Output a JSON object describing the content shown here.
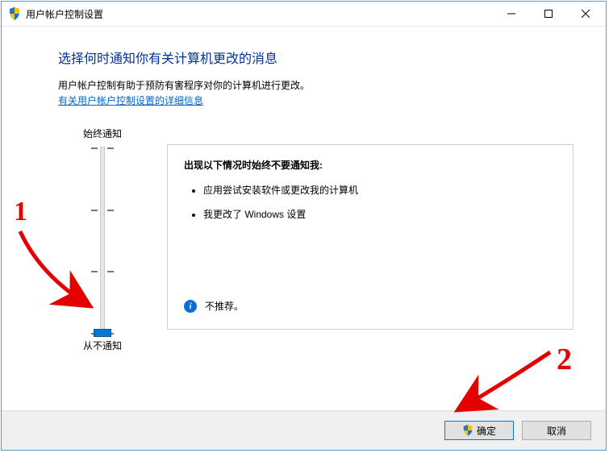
{
  "window": {
    "title": "用户帐户控制设置"
  },
  "heading": "选择何时通知你有关计算机更改的消息",
  "subtext": "用户帐户控制有助于预防有害程序对你的计算机进行更改。",
  "link": "有关用户帐户控制设置的详细信息",
  "slider": {
    "top_label": "始终通知",
    "bottom_label": "从不通知",
    "levels": 4,
    "current_level_index": 3
  },
  "panel": {
    "heading": "出现以下情况时始终不要通知我:",
    "bullets": [
      "应用尝试安装软件或更改我的计算机",
      "我更改了 Windows 设置"
    ],
    "footer_text": "不推荐。"
  },
  "buttons": {
    "ok": "确定",
    "cancel": "取消"
  },
  "annotations": {
    "label1": "1",
    "label2": "2"
  }
}
